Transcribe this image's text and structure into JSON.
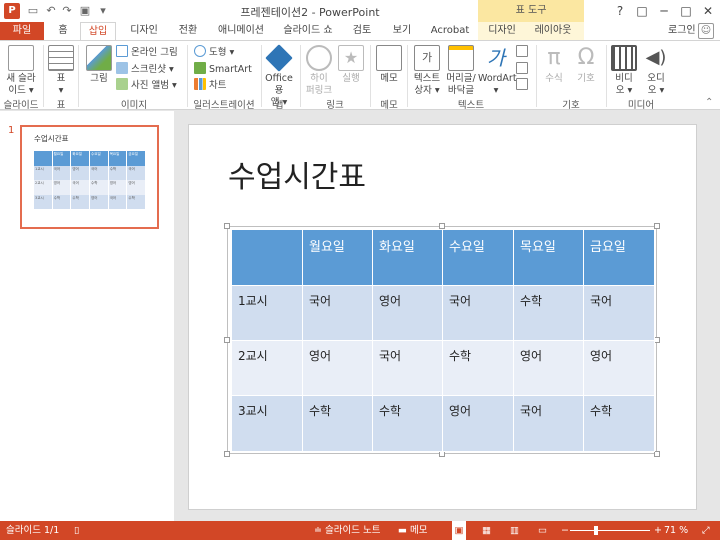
{
  "window": {
    "title": "프레젠테이션2 - PowerPoint",
    "app_logo": "P",
    "context_tab_group": "표 도구",
    "help": "?",
    "restore_icon": "□",
    "minimize": "─",
    "maximize": "□",
    "close": "✕"
  },
  "tabs": [
    {
      "label": "파일"
    },
    {
      "label": "홈"
    },
    {
      "label": "삽입"
    },
    {
      "label": "디자인"
    },
    {
      "label": "전환"
    },
    {
      "label": "애니메이션"
    },
    {
      "label": "슬라이드 쇼"
    },
    {
      "label": "검토"
    },
    {
      "label": "보기"
    },
    {
      "label": "Acrobat"
    },
    {
      "label": "디자인"
    },
    {
      "label": "레이아웃"
    }
  ],
  "active_tab": "삽입",
  "user": {
    "name": "로그인"
  },
  "ribbon": {
    "slides": {
      "new_slide_line1": "새 슬라",
      "new_slide_line2": "이드 ▾",
      "group": "슬라이드"
    },
    "tables": {
      "table": "표",
      "table_arrow": "▾",
      "group": "표"
    },
    "images": {
      "picture": "그림",
      "online_pictures": "온라인 그림",
      "screenshot": "스크린샷 ▾",
      "photo_album": "사진 앨범 ▾",
      "group": "이미지"
    },
    "illustrations": {
      "shapes": "도형 ▾",
      "smartart": "SmartArt",
      "chart": "차트",
      "group": "일러스트레이션"
    },
    "apps": {
      "office_line1": "Office용",
      "office_line2": "앱 ▾",
      "group": "앱"
    },
    "links": {
      "hyperlink_line1": "하이",
      "hyperlink_line2": "퍼링크",
      "action": "실행",
      "group": "링크"
    },
    "comments": {
      "comment": "메모",
      "group": "메모"
    },
    "text": {
      "textbox_line1": "텍스트",
      "textbox_line2": "상자 ▾",
      "header_line1": "머리글/",
      "header_line2": "바닥글",
      "wordart_line1": "WordArt",
      "wordart_line2": "▾",
      "group": "텍스트"
    },
    "symbols": {
      "equation": "수식",
      "symbol": "기호",
      "group": "기호"
    },
    "media": {
      "video_line1": "비디",
      "video_line2": "오 ▾",
      "audio_line1": "오디",
      "audio_line2": "오 ▾",
      "group": "미디어"
    }
  },
  "thumbnail": {
    "number": "1",
    "title": "수업시간표"
  },
  "slide": {
    "title": "수업시간표",
    "table": {
      "headers": [
        "",
        "월요일",
        "화요일",
        "수요일",
        "목요일",
        "금요일"
      ],
      "rows": [
        [
          "1교시",
          "국어",
          "영어",
          "국어",
          "수학",
          "국어"
        ],
        [
          "2교시",
          "영어",
          "국어",
          "수학",
          "영어",
          "영어"
        ],
        [
          "3교시",
          "수학",
          "수학",
          "영어",
          "국어",
          "수학"
        ]
      ]
    }
  },
  "status": {
    "slide_info": "슬라이드 1/1",
    "notes": "슬라이드 노트",
    "comments": "메모",
    "zoom_minus": "−",
    "zoom_plus": "+",
    "zoom": "71 %"
  },
  "colors": {
    "accent": "#d24726",
    "table_header": "#5b9bd5",
    "table_band1": "#d0ddef",
    "table_band2": "#e9eef7",
    "context_tab": "#fbe7a1"
  }
}
